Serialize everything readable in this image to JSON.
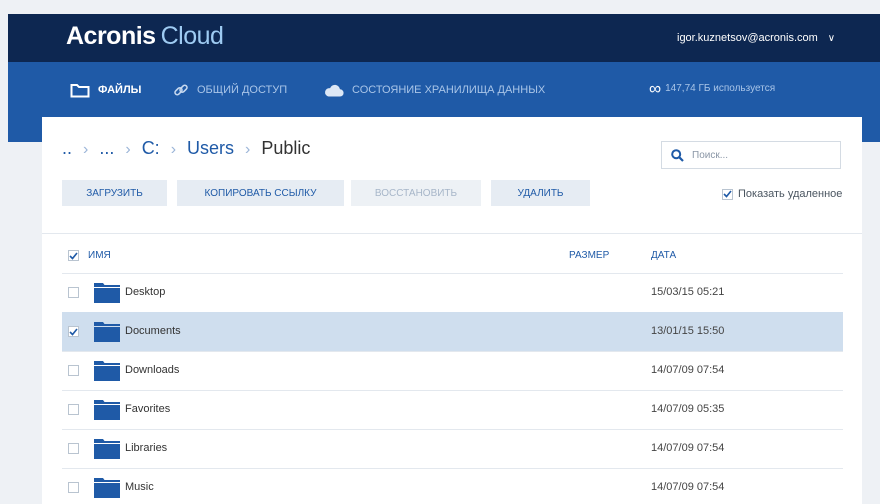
{
  "header": {
    "logo_brand": "Acronis",
    "logo_product": "Cloud",
    "user_email": "igor.kuznetsov@acronis.com",
    "user_menu_icon": "chevron-down-icon"
  },
  "nav": {
    "items": [
      {
        "label": "ФАЙЛЫ",
        "icon": "folder-icon",
        "active": true
      },
      {
        "label": "ОБЩИЙ ДОСТУП",
        "icon": "link-icon",
        "active": false
      },
      {
        "label": "СОСТОЯНИЕ ХРАНИЛИЩА ДАННЫХ",
        "icon": "cloud-icon",
        "active": false
      }
    ],
    "usage_symbol": "∞",
    "usage": "147,74 ГБ используется"
  },
  "breadcrumb": {
    "items": [
      "..",
      "...",
      "C:",
      "Users"
    ],
    "current": "Public",
    "separator": "›"
  },
  "search": {
    "placeholder": "Поиск..."
  },
  "toolbar": {
    "upload": "ЗАГРУЗИТЬ",
    "copy_link": "КОПИРОВАТЬ ССЫЛКУ",
    "restore": "ВОССТАНОВИТЬ",
    "delete": "УДАЛИТЬ",
    "show_deleted": "Показать удаленное",
    "show_deleted_checked": true
  },
  "table": {
    "col_name": "ИМЯ",
    "col_size": "РАЗМЕР",
    "col_date": "ДАТА",
    "rows": [
      {
        "name": "Desktop",
        "date": "15/03/15 05:21",
        "selected": false
      },
      {
        "name": "Documents",
        "date": "13/01/15 15:50",
        "selected": true
      },
      {
        "name": "Downloads",
        "date": "14/07/09 07:54",
        "selected": false
      },
      {
        "name": "Favorites",
        "date": "14/07/09 05:35",
        "selected": false
      },
      {
        "name": "Libraries",
        "date": "14/07/09 07:54",
        "selected": false
      },
      {
        "name": "Music",
        "date": "14/07/09 07:54",
        "selected": false
      }
    ]
  },
  "colors": {
    "header_dark": "#0d2751",
    "nav_blue": "#1f5aa7",
    "accent": "#1f5aa7",
    "selected_row": "#cfdeee",
    "folder": "#1f5aa7"
  }
}
